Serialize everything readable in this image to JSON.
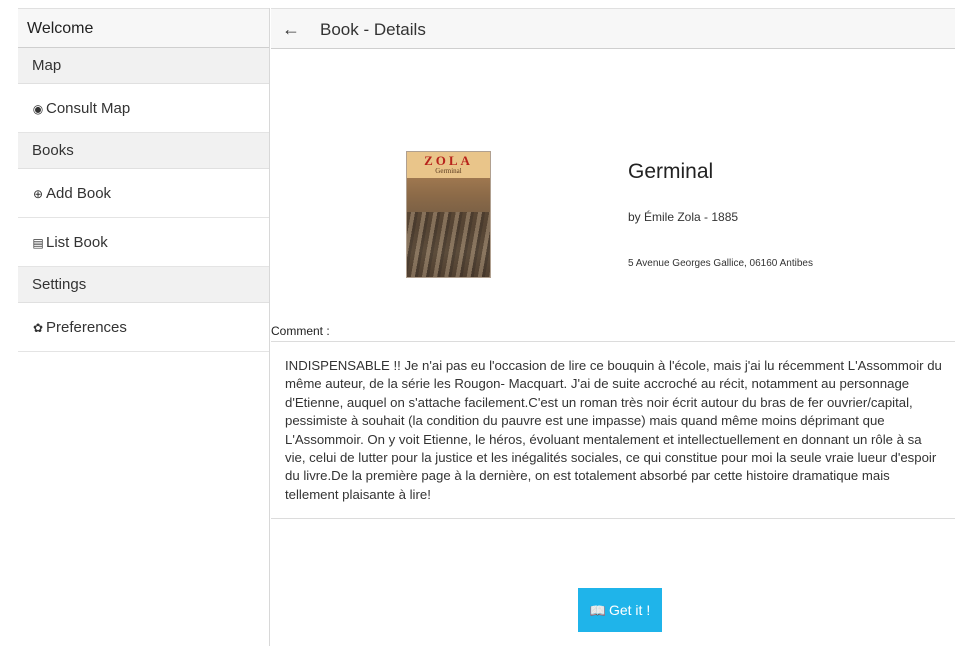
{
  "sidebar": {
    "header": "Welcome",
    "groups": [
      {
        "label": "Map",
        "items": [
          {
            "icon": "globe-icon",
            "glyph": "◉",
            "label": "Consult Map"
          }
        ]
      },
      {
        "label": "Books",
        "items": [
          {
            "icon": "plus-circle-icon",
            "glyph": "⊕",
            "label": "Add Book"
          },
          {
            "icon": "list-icon",
            "glyph": "▤",
            "label": "List Book"
          }
        ]
      },
      {
        "label": "Settings",
        "items": [
          {
            "icon": "gear-icon",
            "glyph": "✿",
            "label": "Preferences"
          }
        ]
      }
    ]
  },
  "header": {
    "back_glyph": "←",
    "title": "Book - Details"
  },
  "book": {
    "cover_title": "ZOLA",
    "cover_subtitle": "Germinal",
    "title": "Germinal",
    "author_line": "by Émile Zola - 1885",
    "address": "5 Avenue Georges Gallice, 06160 Antibes"
  },
  "comment": {
    "label": "Comment :",
    "text": "INDISPENSABLE !! Je n'ai pas eu l'occasion de lire ce bouquin à l'école, mais j'ai lu récemment L'Assommoir du même auteur, de la série les Rougon- Macquart. J'ai de suite accroché au récit, notamment au personnage d'Etienne, auquel on s'attache facilement.C'est un roman très noir écrit autour du bras de fer ouvrier/capital, pessimiste à souhait (la condition du pauvre est une impasse) mais quand même moins déprimant que L'Assommoir. On y voit Etienne, le héros, évoluant mentalement et intellectuellement en donnant un rôle à sa vie, celui de lutter pour la justice et les inégalités sociales, ce qui constitue pour moi la seule vraie lueur d'espoir du livre.De la première page à la dernière, on est totalement absorbé par cette histoire dramatique mais tellement plaisante à lire!"
  },
  "action": {
    "icon": "book-icon",
    "glyph": "📖",
    "label": "Get it !"
  },
  "colors": {
    "accent": "#1fb4ea",
    "sidebar_group_bg": "#f1f1f1"
  }
}
